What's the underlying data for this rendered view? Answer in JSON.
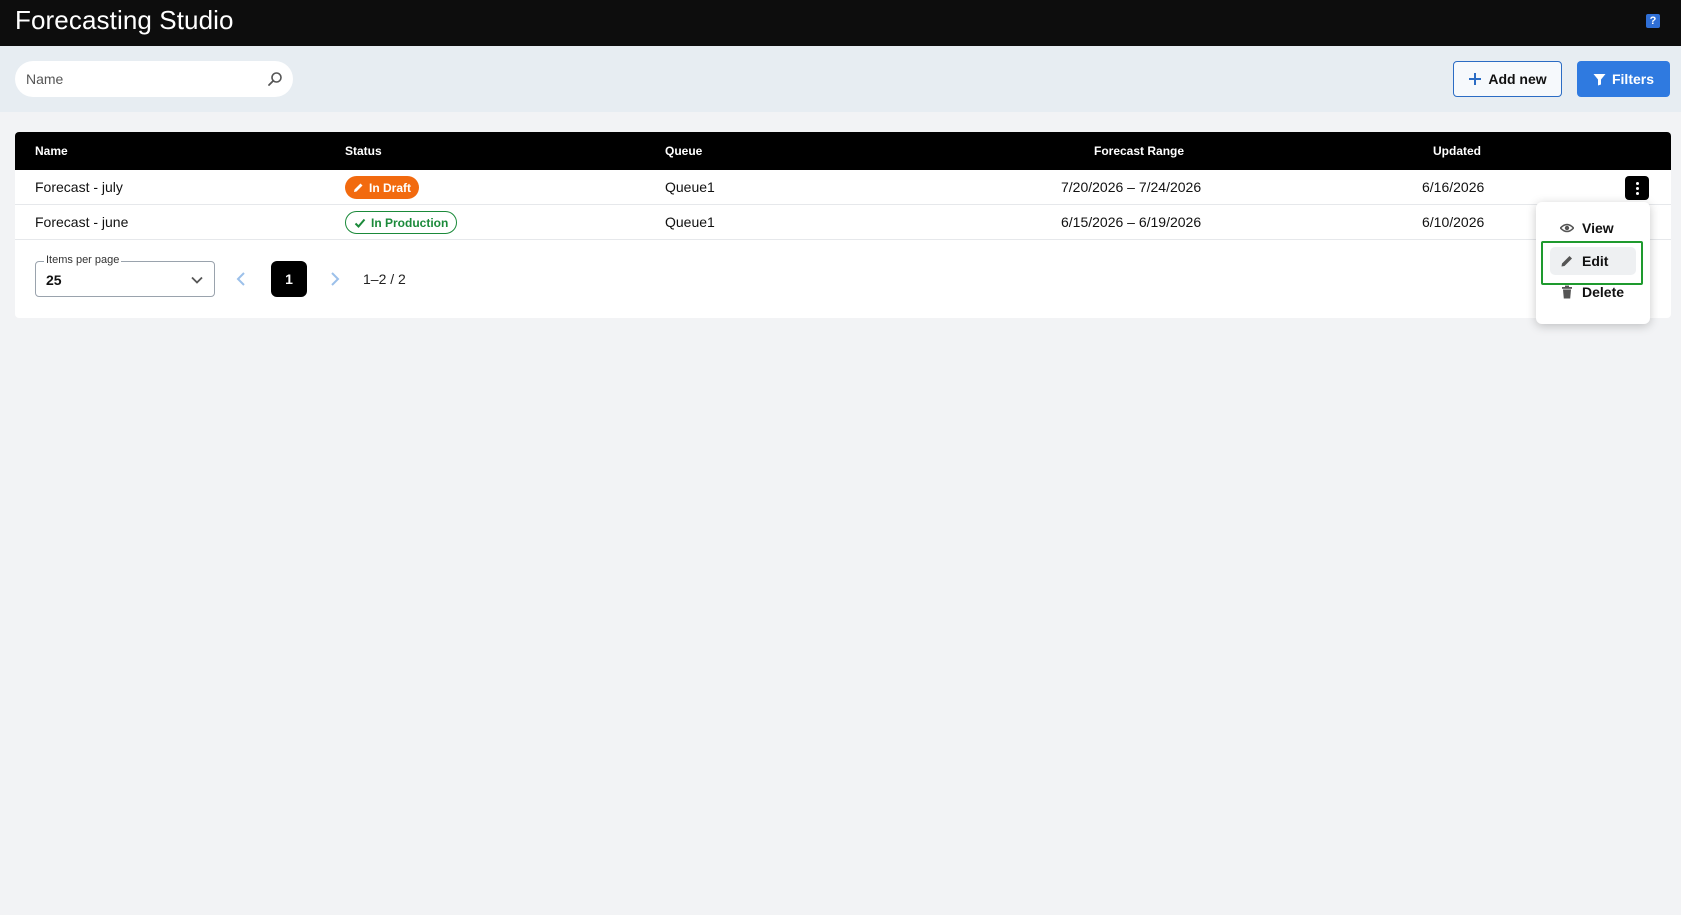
{
  "app": {
    "title": "Forecasting Studio",
    "help_icon_glyph": "?"
  },
  "toolbar": {
    "search_placeholder": "Name",
    "add_new_label": "Add new",
    "filters_label": "Filters"
  },
  "table": {
    "columns": [
      "Name",
      "Status",
      "Queue",
      "Forecast Range",
      "Updated"
    ],
    "rows": [
      {
        "name": "Forecast - july",
        "status": "In Draft",
        "queue": "Queue1",
        "range": "7/20/2026 – 7/24/2026",
        "updated": "6/16/2026"
      },
      {
        "name": "Forecast - june",
        "status": "In Production",
        "queue": "Queue1",
        "range": "6/15/2026 – 6/19/2026",
        "updated": "6/10/2026"
      }
    ]
  },
  "pagination": {
    "items_per_page_label": "Items per page",
    "items_per_page_value": "25",
    "current_page": "1",
    "range_text": "1–2 / 2"
  },
  "context_menu": {
    "items": [
      {
        "label": "View",
        "icon": "eye-icon"
      },
      {
        "label": "Edit",
        "icon": "pencil-icon"
      },
      {
        "label": "Delete",
        "icon": "trash-icon"
      }
    ]
  },
  "colors": {
    "topbar": "#0d0d0d",
    "accent_blue": "#2f7ae0",
    "draft_orange": "#f26a0f",
    "production_green": "#1b8a3a",
    "highlight_green": "#1e9a2e"
  }
}
